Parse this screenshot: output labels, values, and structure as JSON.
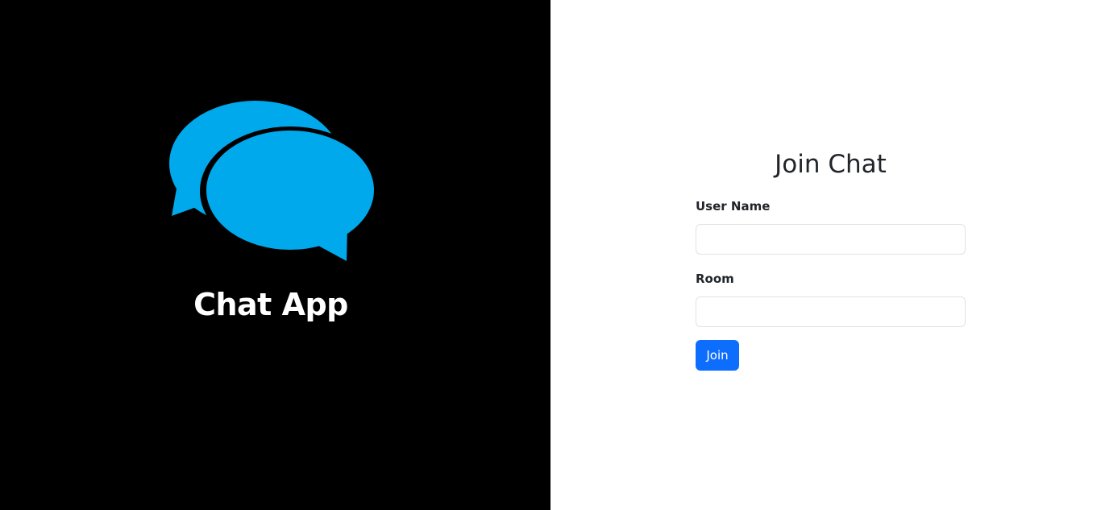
{
  "brand": {
    "title": "Chat App",
    "icon": "chat-bubbles-icon",
    "icon_color": "#00a8ec"
  },
  "form": {
    "title": "Join Chat",
    "username_label": "User Name",
    "username_value": "",
    "room_label": "Room",
    "room_value": "",
    "join_label": "Join"
  },
  "colors": {
    "left_background": "#000000",
    "right_background": "#ffffff",
    "primary_button": "#0d6efd"
  }
}
